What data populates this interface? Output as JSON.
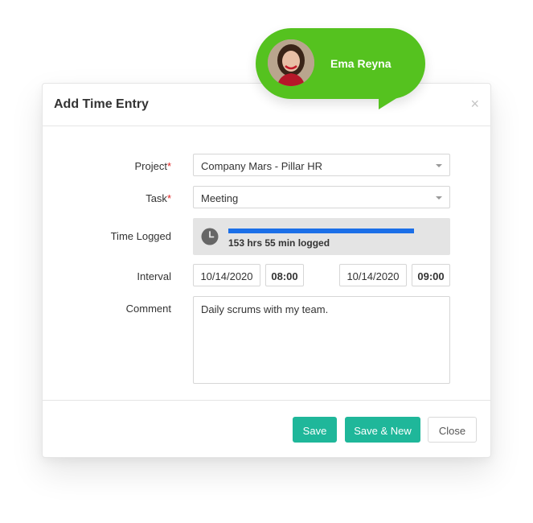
{
  "user": {
    "name": "Ema Reyna"
  },
  "dialog": {
    "title": "Add Time Entry",
    "close_symbol": "×"
  },
  "form": {
    "project": {
      "label": "Project",
      "required_mark": "*",
      "value": "Company Mars - Pillar HR"
    },
    "task": {
      "label": "Task",
      "required_mark": "*",
      "value": "Meeting"
    },
    "time_logged": {
      "label": "Time Logged",
      "text": "153 hrs 55 min logged",
      "progress_fraction": 1.0
    },
    "interval": {
      "label": "Interval",
      "start_date": "10/14/2020",
      "start_time": "08:00",
      "end_date": "10/14/2020",
      "end_time": "09:00"
    },
    "comment": {
      "label": "Comment",
      "value": "Daily scrums with my team."
    }
  },
  "footer": {
    "save_label": "Save",
    "save_new_label": "Save & New",
    "close_label": "Close"
  },
  "colors": {
    "accent_green": "#55c21f",
    "button_teal": "#1fb79a",
    "progress_blue": "#1b6fe8"
  },
  "icons": [
    "clock-icon",
    "dropdown-caret-icon",
    "close-icon"
  ]
}
